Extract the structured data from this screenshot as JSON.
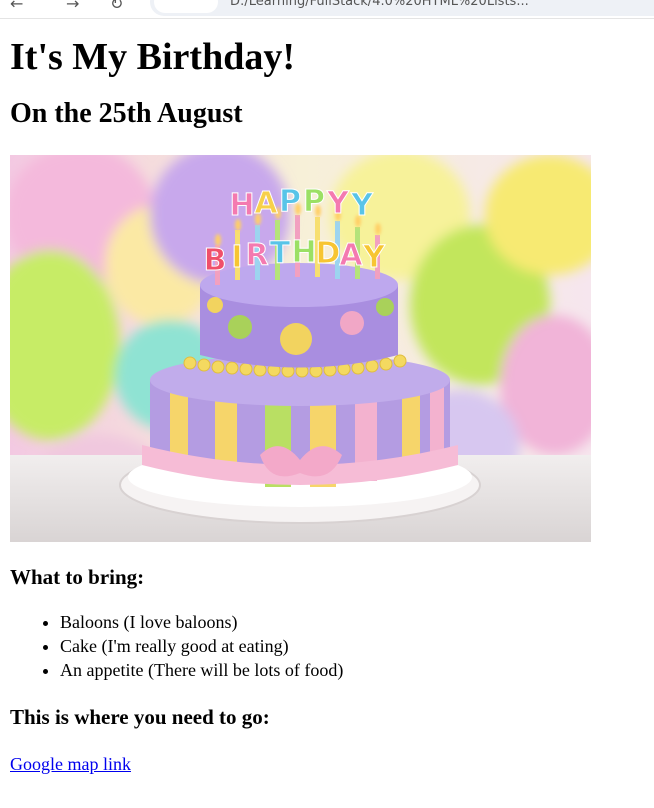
{
  "browser": {
    "url_fragment": "D:/Learning/FullStack/4.0%20HTML%20Lists..."
  },
  "page": {
    "title": "It's My Birthday!",
    "subtitle": "On the 25th August",
    "image": {
      "cake_text": "HAPPY BIRTHDAY"
    },
    "bring_heading": "What to bring:",
    "bring_items": [
      "Baloons (I love baloons)",
      "Cake (I'm really good at eating)",
      "An appetite (There will be lots of food)"
    ],
    "where_heading": "This is where you need to go:",
    "map_link": "Google map link"
  }
}
